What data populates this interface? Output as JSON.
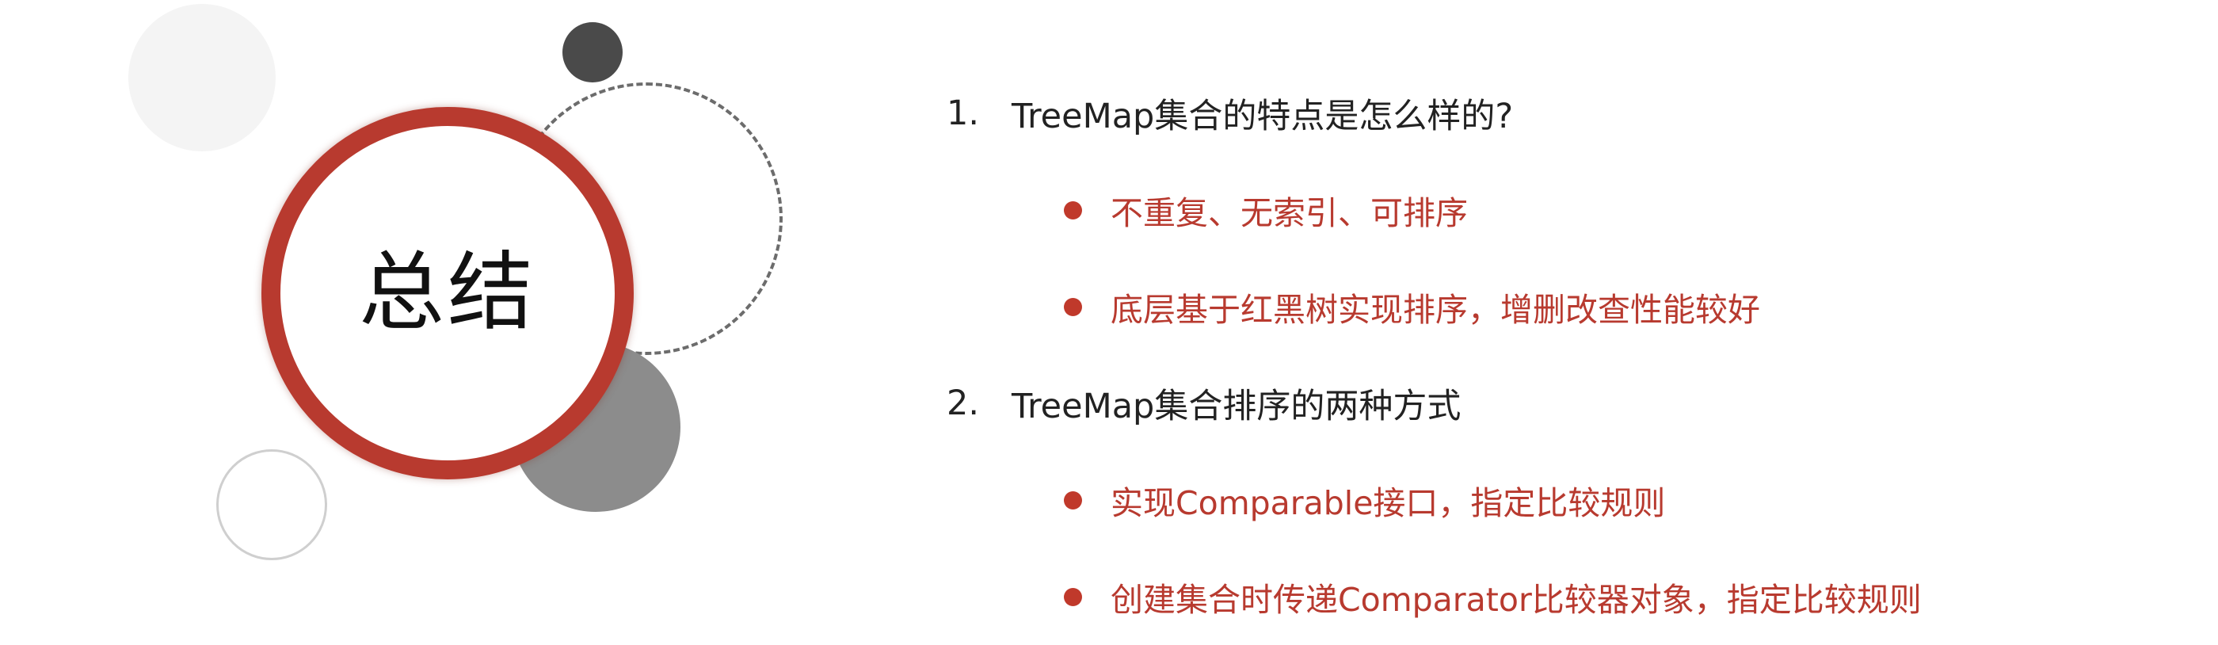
{
  "title": "总结",
  "colors": {
    "accent_red": "#b83a2f",
    "bullet_red": "#c0392b",
    "text_dark": "#222222",
    "deco_dark": "#4a4a4a",
    "deco_gray": "#8c8c8c",
    "deco_light": "#f4f4f4"
  },
  "sections": [
    {
      "number": "1.",
      "question": "TreeMap集合的特点是怎么样的?",
      "bullets": [
        "不重复、无索引、可排序",
        "底层基于红黑树实现排序，增删改查性能较好"
      ]
    },
    {
      "number": "2.",
      "question": "TreeMap集合排序的两种方式",
      "bullets": [
        "实现Comparable接口，指定比较规则",
        "创建集合时传递Comparator比较器对象，指定比较规则"
      ]
    }
  ]
}
